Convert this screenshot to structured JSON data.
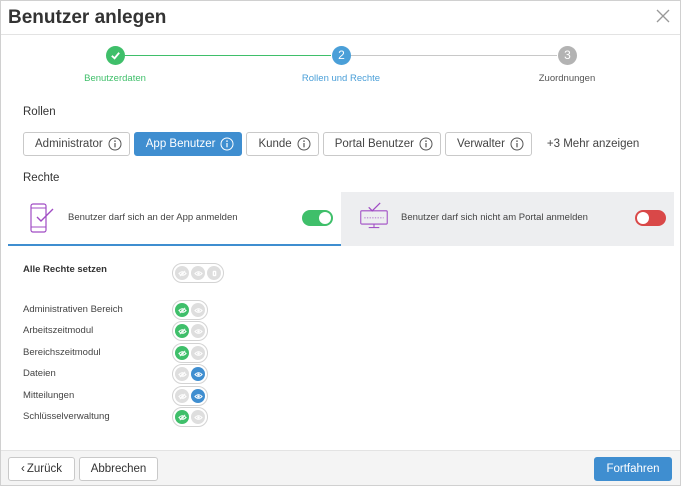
{
  "dialog": {
    "title": "Benutzer anlegen",
    "close_icon": "close-icon"
  },
  "stepper": {
    "steps": [
      {
        "number": "",
        "label": "Benutzerdaten",
        "state": "completed",
        "icon": "check-icon"
      },
      {
        "number": "2",
        "label": "Rollen und Rechte",
        "state": "active"
      },
      {
        "number": "3",
        "label": "Zuordnungen",
        "state": "pending"
      }
    ]
  },
  "roles": {
    "title": "Rollen",
    "items": [
      {
        "label": "Administrator",
        "active": false
      },
      {
        "label": "App Benutzer",
        "active": true
      },
      {
        "label": "Kunde",
        "active": false
      },
      {
        "label": "Portal Benutzer",
        "active": false
      },
      {
        "label": "Verwalter",
        "active": false
      }
    ],
    "more_label": "+3 Mehr anzeigen"
  },
  "rights": {
    "title": "Rechte",
    "tabs": [
      {
        "text": "Benutzer darf sich an der App anmelden",
        "enabled": true,
        "icon": "smartphone-check-icon"
      },
      {
        "text": "Benutzer darf sich nicht am Portal anmelden",
        "enabled": false,
        "icon": "monitor-check-icon"
      }
    ],
    "all_label": "Alle Rechte setzen",
    "items": [
      {
        "label": "Administrativen Bereich",
        "state": "edit"
      },
      {
        "label": "Arbeitszeitmodul",
        "state": "edit"
      },
      {
        "label": "Bereichszeitmodul",
        "state": "edit"
      },
      {
        "label": "Dateien",
        "state": "view"
      },
      {
        "label": "Mitteilungen",
        "state": "view"
      },
      {
        "label": "Schlüsselverwaltung",
        "state": "edit"
      }
    ]
  },
  "footer": {
    "back_label": "Zurück",
    "cancel_label": "Abbrechen",
    "next_label": "Fortfahren"
  },
  "colors": {
    "accent": "#3f8ed0",
    "success": "#3fbf6a",
    "danger": "#d94848",
    "pending": "#b3b3b3"
  }
}
